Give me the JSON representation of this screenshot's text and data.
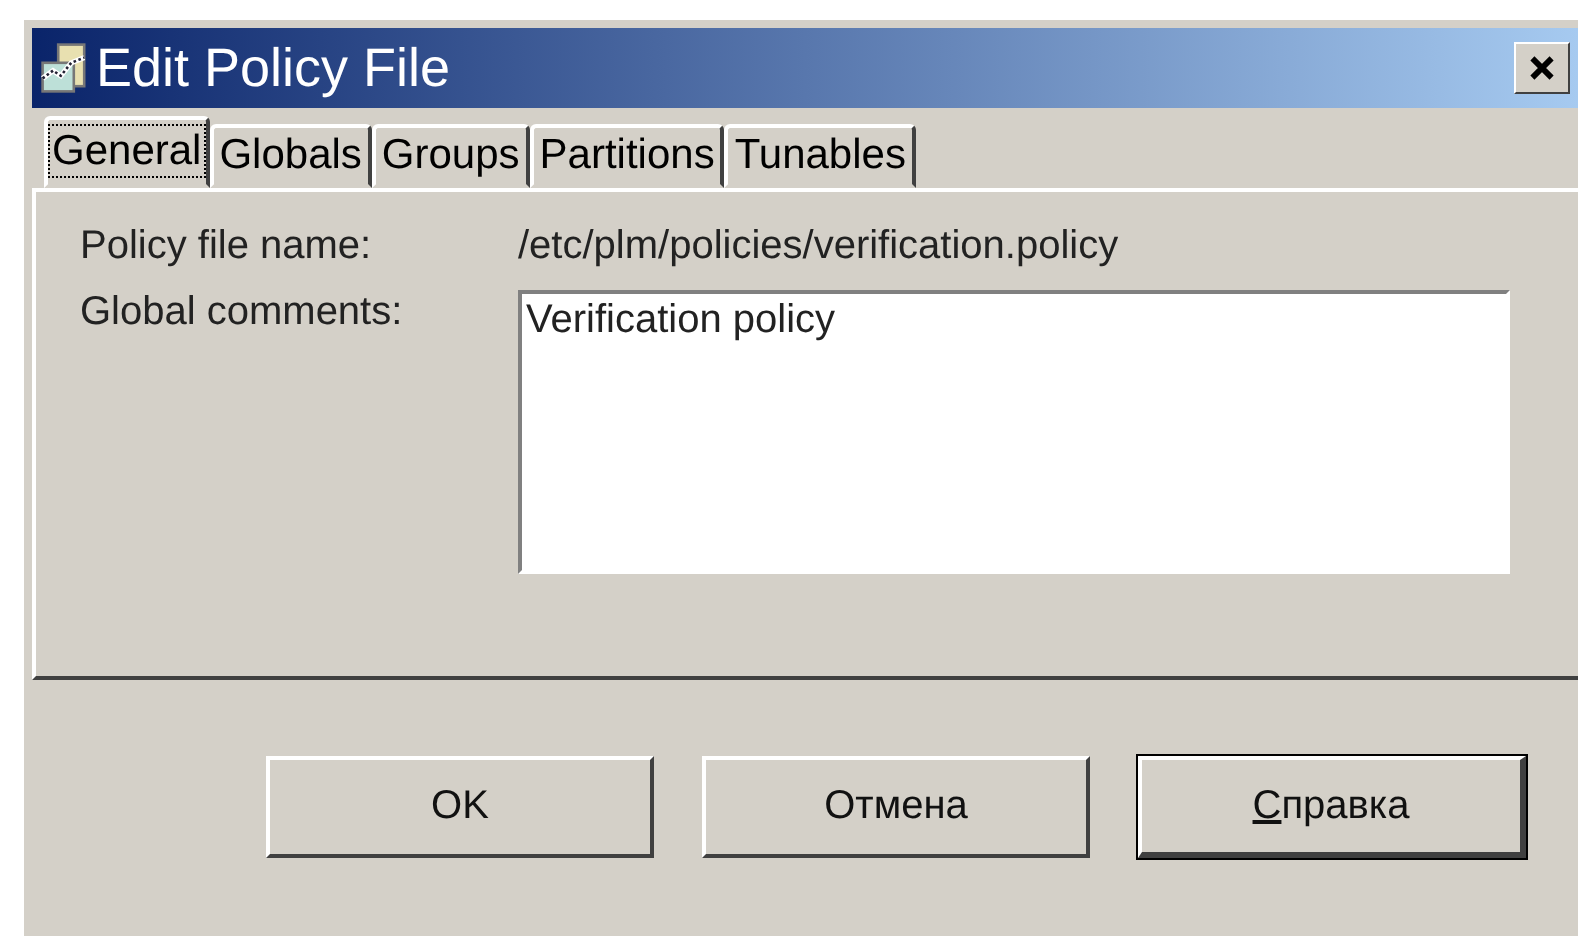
{
  "window": {
    "title": "Edit Policy File"
  },
  "tabs": [
    {
      "label": "General",
      "selected": true
    },
    {
      "label": "Globals",
      "selected": false
    },
    {
      "label": "Groups",
      "selected": false
    },
    {
      "label": "Partitions",
      "selected": false
    },
    {
      "label": "Tunables",
      "selected": false
    }
  ],
  "fields": {
    "policy_file_name": {
      "label": "Policy file name:",
      "value": "/etc/plm/policies/verification.policy"
    },
    "global_comments": {
      "label": "Global comments:",
      "value": "Verification policy"
    }
  },
  "buttons": [
    {
      "label": "OK",
      "underline_first": false,
      "default": false
    },
    {
      "label": "Отмена",
      "underline_first": false,
      "default": false
    },
    {
      "label": "Справка",
      "underline_first": true,
      "default": true
    }
  ]
}
